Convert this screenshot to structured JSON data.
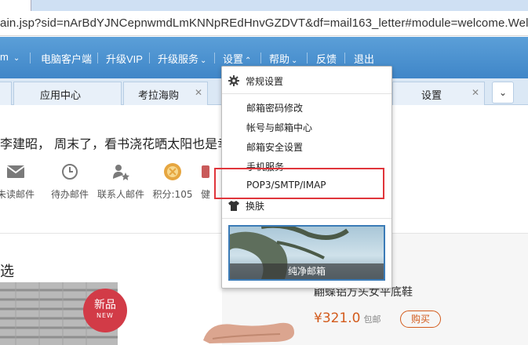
{
  "browser": {
    "address": "ain.jsp?sid=nArBdYJNCepnwmdLmKNNpREdHnvGZDVT&df=mail163_letter#module=welcome.Welco"
  },
  "topnav": {
    "account_suffix": "m",
    "items": [
      {
        "label": "电脑客户端"
      },
      {
        "label": "升级VIP"
      },
      {
        "label": "升级服务"
      },
      {
        "label": "设置"
      },
      {
        "label": "帮助"
      },
      {
        "label": "反馈"
      },
      {
        "label": "退出"
      }
    ]
  },
  "tabs": [
    {
      "label": "应用中心"
    },
    {
      "label": "考拉海购"
    },
    {
      "label": "设置"
    }
  ],
  "content": {
    "greeting": "李建昭， 周末了，看书浇花晒太阳也是幸",
    "quick_actions": [
      {
        "label": "未读邮件",
        "icon": "envelope-icon"
      },
      {
        "label": "待办邮件",
        "icon": "clock-icon"
      },
      {
        "label": "联系人邮件",
        "icon": "contact-star-icon"
      },
      {
        "label": "积分:105",
        "icon": "points-coin-icon"
      },
      {
        "label": "健",
        "icon": "health-icon"
      }
    ],
    "promo_left_heading": "选",
    "badge": {
      "label": "新品",
      "sub": "NEW"
    },
    "product": {
      "title": "翩蝶铝方头女平底鞋",
      "price": "¥321.0",
      "price_note": "包邮",
      "buy_label": "购买"
    }
  },
  "settings_menu": {
    "header": "常规设置",
    "items": [
      {
        "label": "邮箱密码修改"
      },
      {
        "label": "帐号与邮箱中心"
      },
      {
        "label": "邮箱安全设置"
      },
      {
        "label": "手机服务"
      },
      {
        "label": "POP3/SMTP/IMAP"
      }
    ],
    "skin_label": "换肤",
    "theme_name": "纯净邮箱"
  },
  "colors": {
    "topbar": "#4a90d0",
    "highlight": "#e0353b",
    "price": "#d35b1c",
    "badge": "#d23b47"
  }
}
